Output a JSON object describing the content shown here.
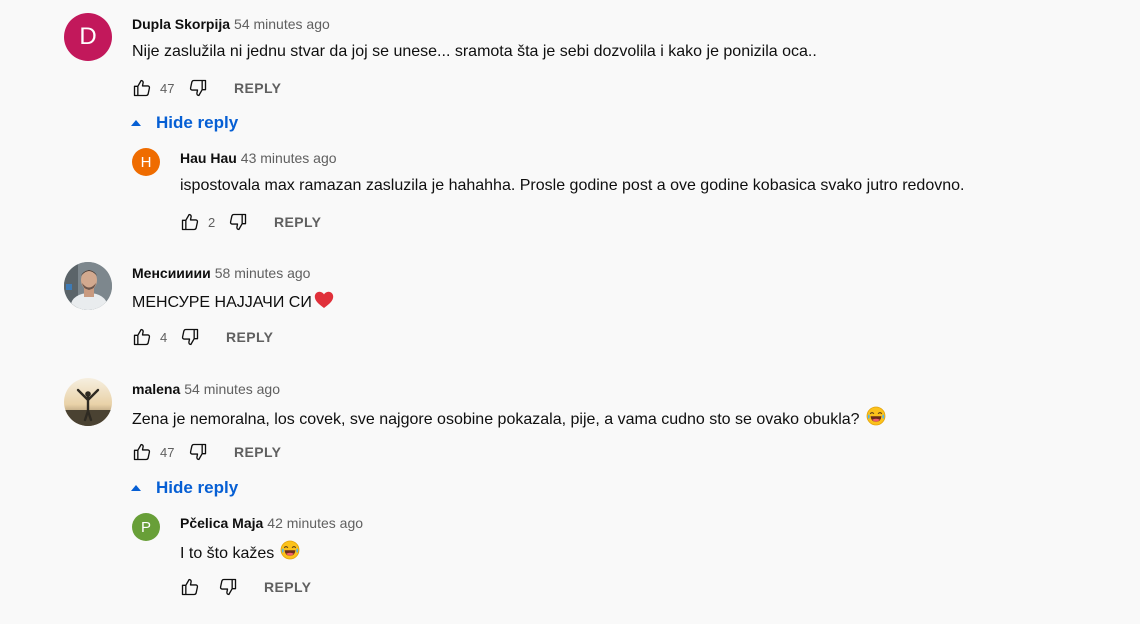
{
  "colors": {
    "link_blue": "#065fd4",
    "meta_gray": "#606060"
  },
  "comments": [
    {
      "author": "Dupla Skorpija",
      "time": "54 minutes ago",
      "text": "Nije zaslužila ni jednu stvar da joj se unese... sramota šta je sebi dozvolila i kako je ponizila oca..",
      "avatar_letter": "D",
      "avatar_color": "#c2185b",
      "likes": "47",
      "reply_label": "REPLY",
      "hide_reply_label": "Hide reply",
      "replies": [
        {
          "author": "Hau Hau",
          "time": "43 minutes ago",
          "text": "ispostovala max ramazan zasluzila je hahahha. Prosle godine post a ove godine kobasica svako jutro redovno.",
          "avatar_letter": "H",
          "avatar_color": "#ef6c00",
          "likes": "2",
          "reply_label": "REPLY"
        }
      ]
    },
    {
      "author": "Менсиииии",
      "time": "58 minutes ago",
      "text": "МЕНСУРЕ НАЈЈАЧИ СИ",
      "emoji": "red-heart-emoji",
      "avatar_photo": "man-photo-avatar",
      "likes": "4",
      "reply_label": "REPLY"
    },
    {
      "author": "malena",
      "time": "54 minutes ago",
      "text": "Zena je nemoralna, los covek, sve najgore osobine pokazala, pije, a vama cudno sto se ovako obukla?",
      "emoji": "laughing-emoji",
      "avatar_photo": "sunset-person-avatar",
      "likes": "47",
      "reply_label": "REPLY",
      "hide_reply_label": "Hide reply",
      "replies": [
        {
          "author": "Pčelica Maja",
          "time": "42 minutes ago",
          "text": "I to što kažes",
          "emoji": "laughing-emoji",
          "avatar_letter": "P",
          "avatar_color": "#689f38",
          "likes": "",
          "reply_label": "REPLY"
        }
      ]
    }
  ]
}
